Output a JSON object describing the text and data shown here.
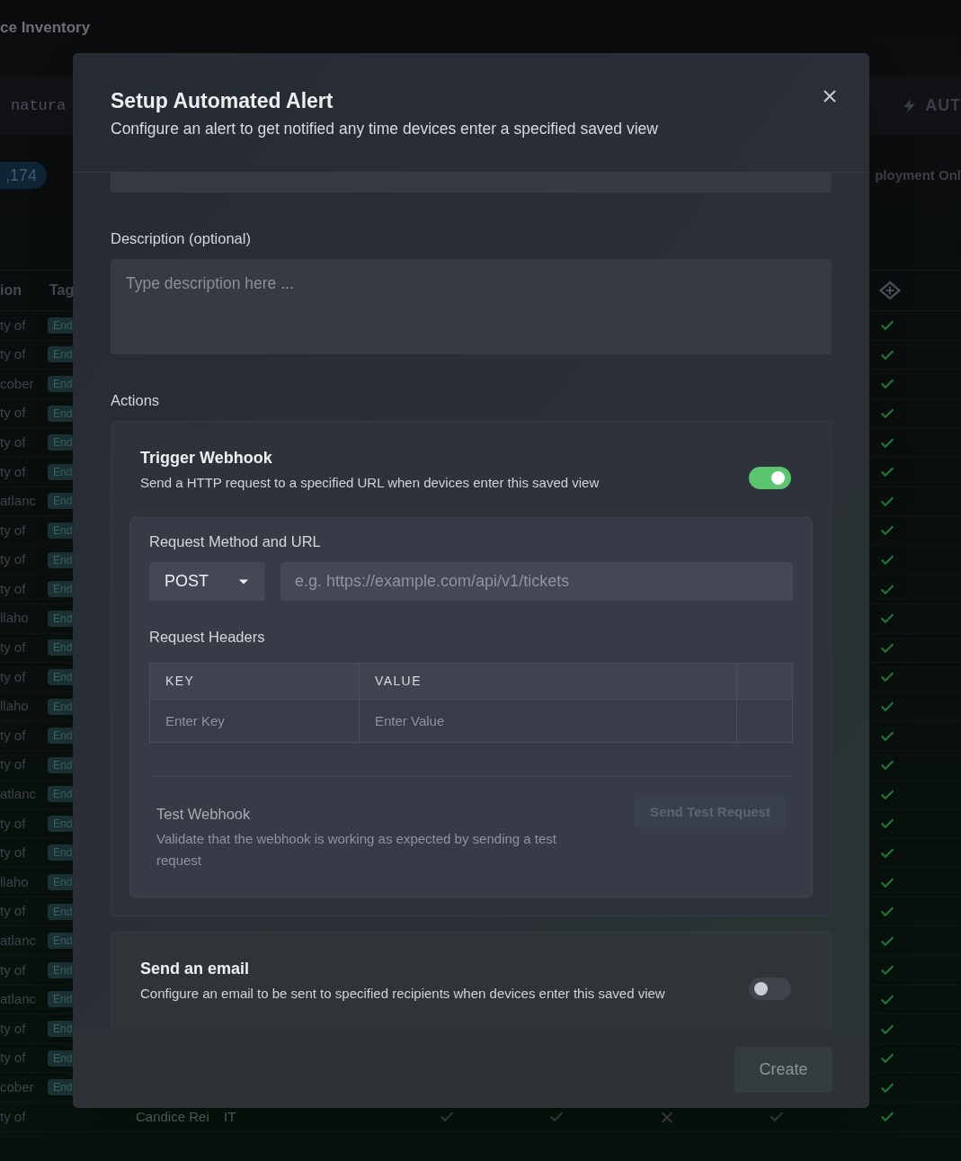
{
  "background": {
    "page_title": "ce Inventory",
    "search": {
      "value": "natura"
    },
    "automation_button": "AUT",
    "count_badge": ",174",
    "filter_chip": "ployment Onl",
    "table": {
      "columns": [
        "ion",
        "Tag"
      ],
      "rows": [
        {
          "cell": "ty of",
          "tag": "End",
          "checks": [
            true
          ]
        },
        {
          "cell": "ty of",
          "tag": "End",
          "checks": [
            true
          ]
        },
        {
          "cell": "cober",
          "tag": "End",
          "checks": [
            true
          ]
        },
        {
          "cell": "ty of",
          "tag": "End",
          "checks": [
            true
          ]
        },
        {
          "cell": "ty of",
          "tag": "End",
          "checks": [
            true
          ]
        },
        {
          "cell": "ty of",
          "tag": "End",
          "checks": [
            true
          ]
        },
        {
          "cell": "atlanc",
          "tag": "End",
          "checks": [
            true
          ]
        },
        {
          "cell": "ty of",
          "tag": "End",
          "checks": [
            true
          ]
        },
        {
          "cell": "ty of",
          "tag": "End",
          "checks": [
            true
          ]
        },
        {
          "cell": "ty of",
          "tag": "End",
          "checks": [
            true
          ]
        },
        {
          "cell": "llaho",
          "tag": "End",
          "checks": [
            true
          ]
        },
        {
          "cell": "ty of",
          "tag": "End",
          "checks": [
            true
          ]
        },
        {
          "cell": "ty of",
          "tag": "End",
          "checks": [
            true
          ]
        },
        {
          "cell": "llaho",
          "tag": "End",
          "checks": [
            true
          ]
        },
        {
          "cell": "ty of",
          "tag": "End",
          "checks": [
            true
          ]
        },
        {
          "cell": "ty of",
          "tag": "End",
          "checks": [
            true
          ]
        },
        {
          "cell": "atlanc",
          "tag": "End",
          "checks": [
            true
          ]
        },
        {
          "cell": "ty of",
          "tag": "End",
          "checks": [
            true
          ]
        },
        {
          "cell": "ty of",
          "tag": "End",
          "checks": [
            true
          ]
        },
        {
          "cell": "llaho",
          "tag": "End",
          "checks": [
            true
          ]
        },
        {
          "cell": "ty of",
          "tag": "End",
          "checks": [
            true
          ]
        },
        {
          "cell": "atlanc",
          "tag": "End",
          "checks": [
            true
          ]
        },
        {
          "cell": "ty of",
          "tag": "End",
          "checks": [
            true
          ]
        },
        {
          "cell": "atlanc",
          "tag": "End",
          "checks": [
            true
          ]
        },
        {
          "cell": "ty of",
          "tag": "End",
          "checks": [
            true
          ]
        },
        {
          "cell": "ty of",
          "tag": "End",
          "checks": [
            true
          ]
        },
        {
          "cell": "cober",
          "tag": "End",
          "checks": [
            true
          ]
        },
        {
          "cell": "ty of",
          "owner": "Candice Rei",
          "department": "IT",
          "checks": [
            true,
            true,
            false,
            true,
            true
          ]
        }
      ]
    }
  },
  "modal": {
    "title": "Setup Automated Alert",
    "subtitle": "Configure an alert to get notified any time devices enter a specified saved view",
    "description": {
      "label": "Description (optional)",
      "placeholder": "Type description here ..."
    },
    "actions_label": "Actions",
    "webhook": {
      "title": "Trigger Webhook",
      "description": "Send a HTTP request to a specified URL when devices enter this saved view",
      "enabled": true,
      "method_label": "Request Method and URL",
      "method": "POST",
      "url_placeholder": "e.g. https://example.com/api/v1/tickets",
      "headers_label": "Request Headers",
      "headers": {
        "columns": [
          "KEY",
          "VALUE"
        ],
        "key_placeholder": "Enter Key",
        "value_placeholder": "Enter Value"
      },
      "test": {
        "title": "Test Webhook",
        "description": "Validate that the webhook is working as expected by sending a test request",
        "button": "Send Test Request",
        "button_disabled": true
      }
    },
    "email": {
      "title": "Send an email",
      "description": "Configure an email to be sent to specified recipients when devices enter this saved view",
      "enabled": false
    },
    "create_button": {
      "label": "Create",
      "disabled": true
    }
  }
}
